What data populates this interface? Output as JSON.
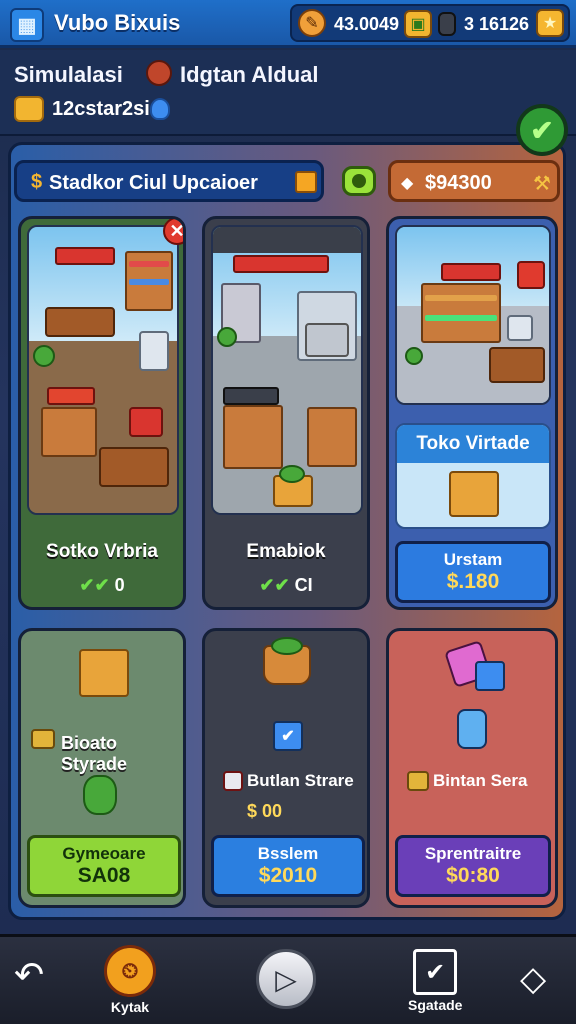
{
  "app": {
    "title": "Vubo Bixuis",
    "icon": "app-grid-icon"
  },
  "currency": {
    "primary_value": "43.0049",
    "secondary_value": "3 16126",
    "primary_icon": "ticket-icon",
    "secondary_icon": "crate-icon",
    "star_icon": "star-icon"
  },
  "header": {
    "title": "Simulalasi",
    "subtitle": "Idgtan Aldual",
    "coins": "12cstar2si"
  },
  "toolbar": {
    "banner_label": "Stadkor Ciul Upcaioer",
    "price": "$94300"
  },
  "cards": [
    {
      "label": "Sotko Vrbria",
      "stat": "0"
    },
    {
      "label": "Emabiok",
      "stat": "CI"
    },
    {
      "title": "Toko Virtade",
      "button_top": "Urstam",
      "button_price": "$.180"
    }
  ],
  "upgrades": [
    {
      "label": "Bioato Styrade",
      "button_top": "Gymeoare",
      "button_price": "SA08"
    },
    {
      "label": "Butlan Strare",
      "stat": "$ 00",
      "button_top": "Bsslem",
      "button_price": "$2010"
    },
    {
      "label": "Bintan Sera",
      "button_top": "Sprentraitre",
      "button_price": "$0:80"
    }
  ],
  "nav": [
    {
      "label": ""
    },
    {
      "label": "Kytak"
    },
    {
      "label": ""
    },
    {
      "label": "Sgatade"
    },
    {
      "label": ""
    }
  ],
  "colors": {
    "green_button": "#8fd638",
    "blue_button": "#2b7fe0",
    "purple_button": "#6a3fb8",
    "gold": "#ffd95a"
  }
}
